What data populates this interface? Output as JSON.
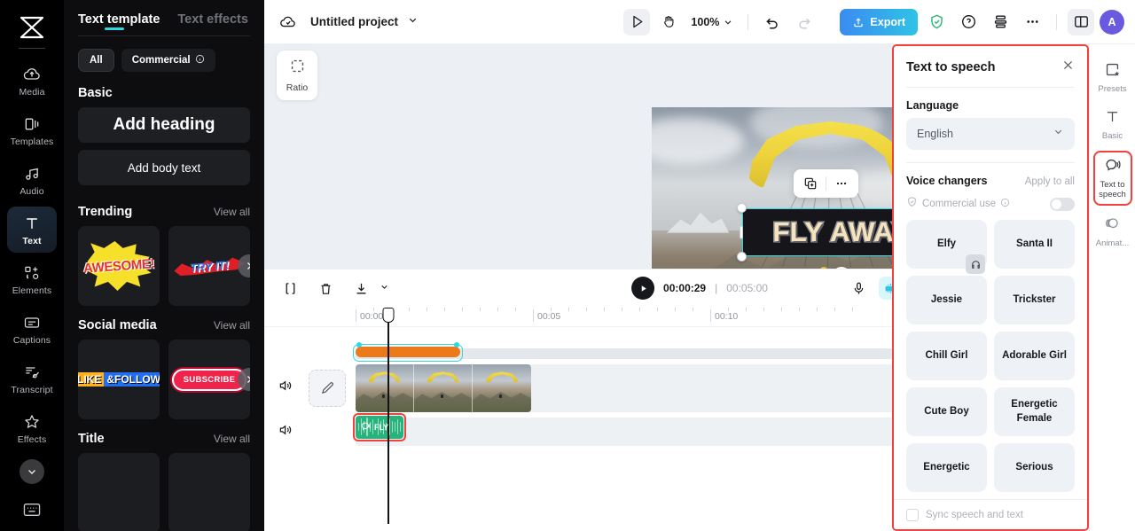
{
  "left_rail": {
    "logo": "capcut-logo-icon",
    "items": [
      {
        "label": "Media",
        "icon": "cloud-upload-icon",
        "active": false
      },
      {
        "label": "Templates",
        "icon": "templates-icon",
        "active": false
      },
      {
        "label": "Audio",
        "icon": "music-note-icon",
        "active": false
      },
      {
        "label": "Text",
        "icon": "text-t-icon",
        "active": true
      },
      {
        "label": "Elements",
        "icon": "elements-icon",
        "active": false
      },
      {
        "label": "Captions",
        "icon": "captions-icon",
        "active": false
      },
      {
        "label": "Transcript",
        "icon": "transcript-icon",
        "active": false
      },
      {
        "label": "Effects",
        "icon": "sparkle-star-icon",
        "active": false
      }
    ],
    "expand_more": "chevron-down-icon",
    "keyboard_shortcut": "keyboard-icon"
  },
  "left_panel": {
    "tabs": [
      {
        "label": "Text template",
        "active": true
      },
      {
        "label": "Text effects",
        "active": false
      }
    ],
    "filters": [
      {
        "label": "All",
        "selected": true
      },
      {
        "label": "Commercial",
        "selected": false,
        "info_icon": "info-circle-icon"
      }
    ],
    "sections": [
      {
        "title": "Basic",
        "view_all": "",
        "buttons": [
          {
            "label": "Add heading"
          },
          {
            "label": "Add body text"
          }
        ]
      },
      {
        "title": "Trending",
        "view_all": "View all",
        "tiles": [
          {
            "label": "AWESOME!"
          },
          {
            "label": "TRY IT!"
          }
        ]
      },
      {
        "title": "Social media",
        "view_all": "View all",
        "tiles": [
          {
            "label": "LIKE &FOLLOW"
          },
          {
            "label": "SUBSCRIBE"
          }
        ]
      },
      {
        "title": "Title",
        "view_all": "View all",
        "tiles": [
          {
            "label": ""
          },
          {
            "label": ""
          }
        ]
      }
    ],
    "collapse_icon": "chevron-left-icon"
  },
  "topbar": {
    "cloud_icon": "cloud-check-icon",
    "project_name": "Untitled project",
    "project_dropdown_icon": "chevron-down-icon",
    "select_tool_icon": "cursor-arrow-icon",
    "hand_tool_icon": "hand-icon",
    "zoom_level": "100%",
    "zoom_dropdown_icon": "chevron-down-icon",
    "undo_icon": "undo-arrow-icon",
    "redo_icon": "redo-arrow-icon",
    "export_label": "Export",
    "export_icon": "upload-icon",
    "shield_icon": "shield-check-icon",
    "help_icon": "question-circle-icon",
    "print_icon": "layers-icon",
    "more_icon": "ellipsis-icon",
    "layout_icon": "panel-layout-icon",
    "avatar_initial": "A"
  },
  "stage": {
    "ratio_label": "Ratio",
    "ratio_icon": "crop-dashed-icon",
    "canvas_text": "FLY AWAY",
    "float_tools": [
      {
        "icon": "duplicate-add-icon",
        "name": "duplicate"
      },
      {
        "icon": "ellipsis-icon",
        "name": "more"
      }
    ],
    "rotate_icon": "rotate-icon"
  },
  "timeline": {
    "split_icon": "split-clip-icon",
    "delete_icon": "trash-icon",
    "download_icon": "download-icon",
    "download_dropdown_icon": "chevron-down-icon",
    "play_icon": "play-icon",
    "current_time": "00:00:29",
    "time_separator": "|",
    "total_time": "00:05:00",
    "mic_icon": "microphone-icon",
    "autocaption_icon": "auto-captions-icon",
    "mirror_icon": "mirror-split-icon",
    "zoom_out_icon": "minus-circle-icon",
    "zoom_in_icon": "plus-circle-icon",
    "fit_icon": "fit-screen-icon",
    "marker_icon": "marker-icon",
    "ruler_labels": [
      "00:00",
      "00:05",
      "00:10"
    ],
    "tracks": [
      {
        "name": "video-track",
        "volume_icon": "speaker-icon",
        "edit_icon": "pencil-icon",
        "clip_label": ""
      },
      {
        "name": "audio-track",
        "volume_icon": "speaker-icon",
        "clip_label": "FLY",
        "clip_icon": "text-to-speech-icon"
      }
    ]
  },
  "tts": {
    "title": "Text to speech",
    "close_icon": "close-icon",
    "language_label": "Language",
    "language_value": "English",
    "language_dropdown_icon": "chevron-down-icon",
    "voice_changers_label": "Voice changers",
    "apply_to_all_label": "Apply to all",
    "commercial_use_label": "Commercial use",
    "commercial_use_shield_icon": "shield-check-icon",
    "commercial_use_info_icon": "info-circle-icon",
    "commercial_toggle_on": false,
    "voices": [
      {
        "name": "Elfy",
        "headphone_icon": "headphone-icon"
      },
      {
        "name": "Santa II"
      },
      {
        "name": "Jessie"
      },
      {
        "name": "Trickster"
      },
      {
        "name": "Chill Girl"
      },
      {
        "name": "Adorable Girl"
      },
      {
        "name": "Cute Boy"
      },
      {
        "name": "Energetic Female"
      },
      {
        "name": "Energetic"
      },
      {
        "name": "Serious"
      }
    ],
    "sync_label": "Sync speech and text",
    "sync_checked": false
  },
  "right_rail": {
    "items": [
      {
        "label": "Presets",
        "icon": "presets-icon",
        "selected": false
      },
      {
        "label": "Basic",
        "icon": "text-t-icon",
        "selected": false
      },
      {
        "label": "Text to speech",
        "icon": "text-to-speech-icon",
        "selected": true
      },
      {
        "label": "Animat...",
        "icon": "animation-icon",
        "selected": false
      }
    ]
  },
  "colors": {
    "accent_cyan": "#2fd8e0",
    "highlight_red": "#f2413c",
    "export_blue": "#3b8bf0",
    "audio_green": "#27b37c",
    "orange_bar": "#ec7a19",
    "avatar_purple": "#6a5ae0"
  }
}
